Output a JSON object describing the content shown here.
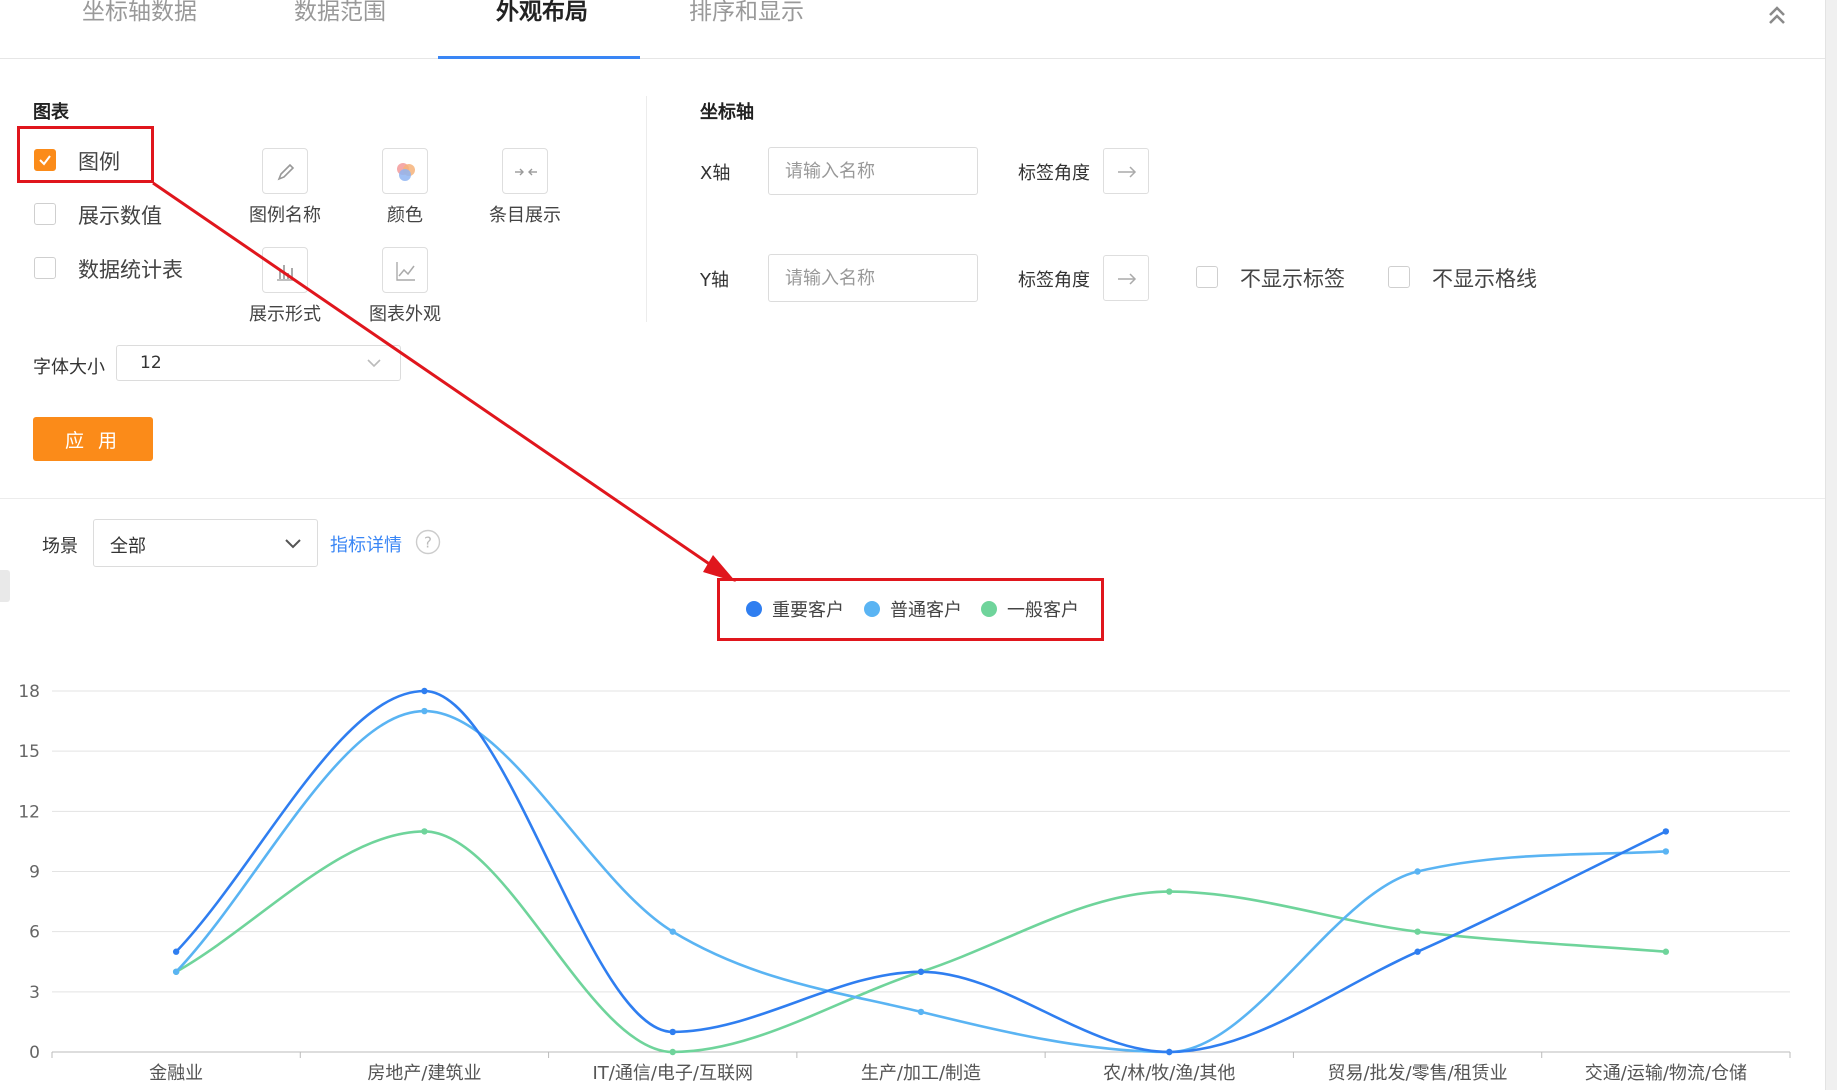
{
  "tabs": [
    {
      "label": "坐标轴数据",
      "active": false
    },
    {
      "label": "数据范围",
      "active": false
    },
    {
      "label": "外观布局",
      "active": true
    },
    {
      "label": "排序和显示",
      "active": false
    }
  ],
  "chart_section": {
    "title": "图表",
    "checkboxes": [
      {
        "label": "图例",
        "checked": true
      },
      {
        "label": "展示数值",
        "checked": false
      },
      {
        "label": "数据统计表",
        "checked": false
      }
    ],
    "icon_buttons": [
      {
        "label": "图例名称",
        "icon": "pencil-icon"
      },
      {
        "label": "颜色",
        "icon": "color-palette-icon"
      },
      {
        "label": "条目展示",
        "icon": "arrows-inward-icon"
      },
      {
        "label": "展示形式",
        "icon": "bar-chart-icon"
      },
      {
        "label": "图表外观",
        "icon": "line-chart-icon"
      }
    ],
    "font_size_label": "字体大小",
    "font_size_value": "12",
    "apply_label": "应 用"
  },
  "axis_section": {
    "title": "坐标轴",
    "x_axis_label": "X轴",
    "y_axis_label": "Y轴",
    "name_placeholder": "请输入名称",
    "label_angle": "标签角度",
    "hide_labels": "不显示标签",
    "hide_gridlines": "不显示格线"
  },
  "filter": {
    "scene_label": "场景",
    "scene_value": "全部",
    "metric_link": "指标详情"
  },
  "colors": {
    "accent": "#fb8b19",
    "tab_underline": "#3a86f5",
    "annotation": "#e0161d"
  },
  "chart_data": {
    "type": "line",
    "smooth": true,
    "categories": [
      "金融业",
      "房地产/建筑业",
      "IT/通信/电子/互联网",
      "生产/加工/制造",
      "农/林/牧/渔/其他",
      "贸易/批发/零售/租赁业",
      "交通/运输/物流/仓储"
    ],
    "series": [
      {
        "name": "重要客户",
        "color": "#2f7ef0",
        "values": [
          5,
          18,
          1,
          4,
          0,
          5,
          11
        ]
      },
      {
        "name": "普通客户",
        "color": "#5ab4f3",
        "values": [
          4,
          17,
          6,
          2,
          0,
          9,
          10
        ]
      },
      {
        "name": "一般客户",
        "color": "#6fd49b",
        "values": [
          4,
          11,
          0,
          4,
          8,
          6,
          5
        ]
      }
    ],
    "ylim": [
      0,
      18
    ],
    "yticks": [
      "0",
      "3",
      "6",
      "9",
      "12",
      "15",
      "18"
    ],
    "grid": true,
    "legend_position": "top-center"
  }
}
